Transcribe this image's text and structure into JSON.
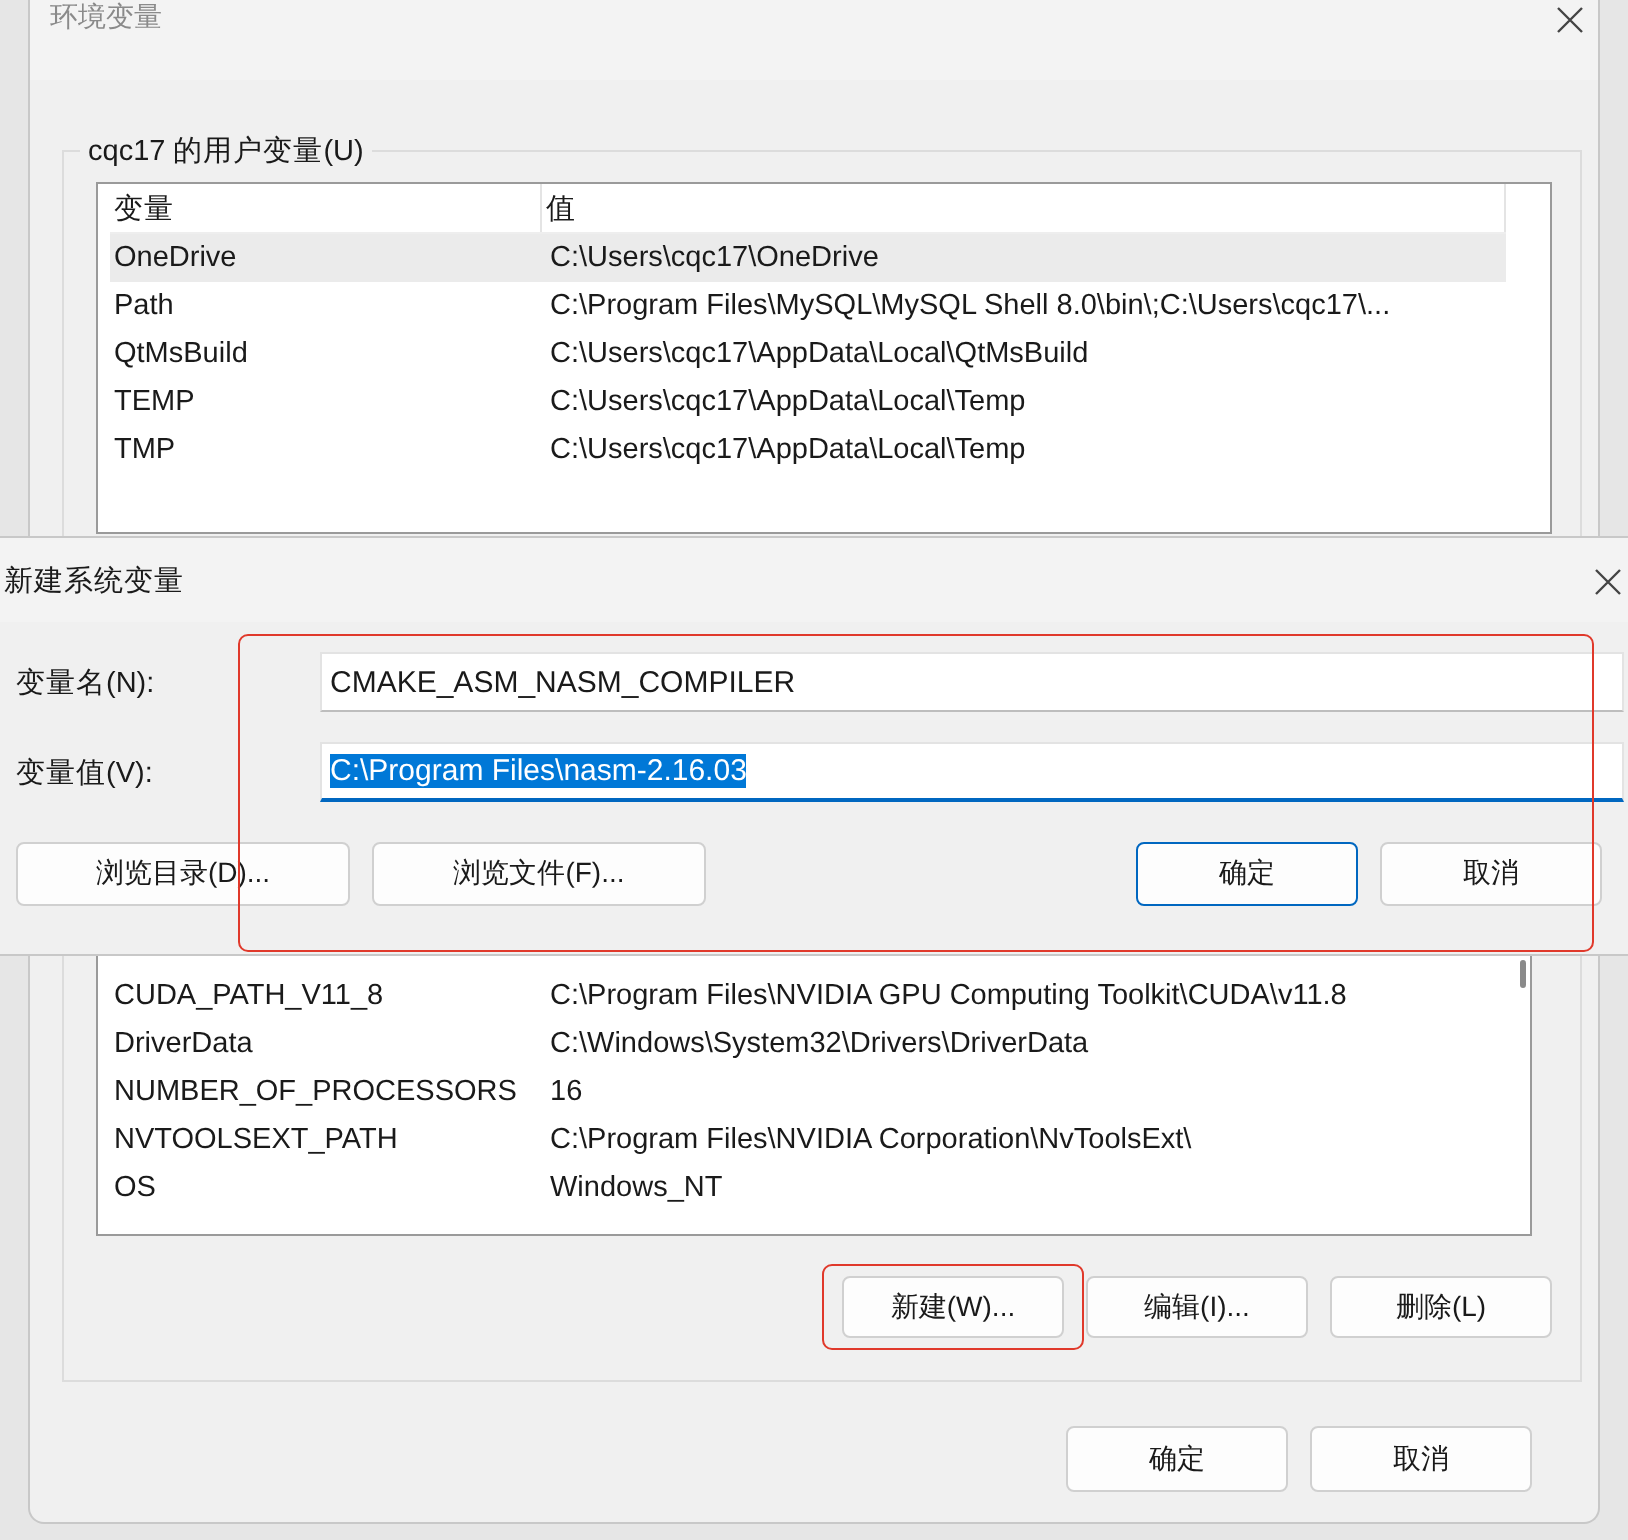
{
  "window": {
    "title": "环境变量"
  },
  "user_variables": {
    "title": "cqc17 的用户变量(U)",
    "columns": [
      "变量",
      "值"
    ],
    "rows": [
      {
        "name": "OneDrive",
        "value": "C:\\Users\\cqc17\\OneDrive",
        "selected": true
      },
      {
        "name": "Path",
        "value": "C:\\Program Files\\MySQL\\MySQL Shell 8.0\\bin\\;C:\\Users\\cqc17\\...",
        "selected": false
      },
      {
        "name": "QtMsBuild",
        "value": "C:\\Users\\cqc17\\AppData\\Local\\QtMsBuild",
        "selected": false
      },
      {
        "name": "TEMP",
        "value": "C:\\Users\\cqc17\\AppData\\Local\\Temp",
        "selected": false
      },
      {
        "name": "TMP",
        "value": "C:\\Users\\cqc17\\AppData\\Local\\Temp",
        "selected": false
      }
    ]
  },
  "system_variables": {
    "rows": [
      {
        "name": "CUDA_PATH_V11_8",
        "value": "C:\\Program Files\\NVIDIA GPU Computing Toolkit\\CUDA\\v11.8"
      },
      {
        "name": "DriverData",
        "value": "C:\\Windows\\System32\\Drivers\\DriverData"
      },
      {
        "name": "NUMBER_OF_PROCESSORS",
        "value": "16"
      },
      {
        "name": "NVTOOLSEXT_PATH",
        "value": "C:\\Program Files\\NVIDIA Corporation\\NvToolsExt\\"
      },
      {
        "name": "OS",
        "value": "Windows_NT"
      }
    ],
    "buttons": [
      {
        "label": "新建(W)...",
        "highlighted": true
      },
      {
        "label": "编辑(I)...",
        "highlighted": false
      },
      {
        "label": "删除(L)",
        "highlighted": false
      }
    ]
  },
  "buttons": [
    "确定",
    "取消"
  ],
  "dialog": {
    "title": "新建系统变量",
    "fields": [
      {
        "label": "变量名(N):",
        "value": "CMAKE_ASM_NASM_COMPILER",
        "focused": false
      },
      {
        "label": "变量值(V):",
        "value": "C:\\Program Files\\nasm-2.16.03",
        "focused": true
      }
    ],
    "highlighted": true,
    "browse_buttons": [
      "浏览目录(D)...",
      "浏览文件(F)..."
    ],
    "buttons": [
      {
        "label": "确定",
        "default": true
      },
      {
        "label": "取消",
        "default": false
      }
    ]
  }
}
